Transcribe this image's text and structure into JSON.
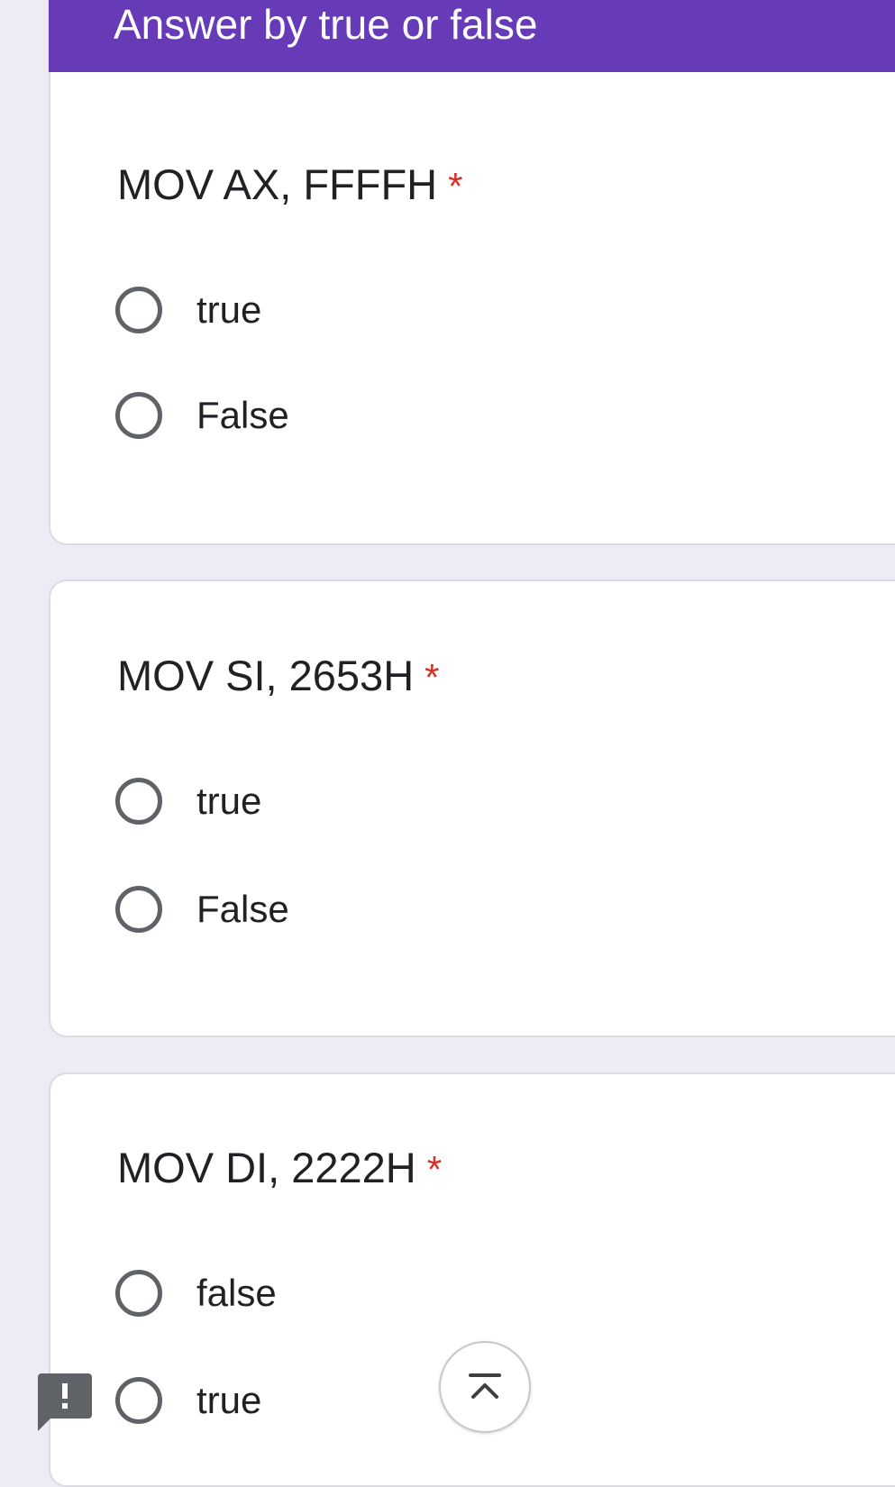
{
  "header": {
    "title": "Answer by true or false",
    "color": "#673ab7"
  },
  "questions": [
    {
      "title": "MOV AX, FFFFH",
      "required_mark": "*",
      "options": [
        {
          "label": "true",
          "selected": false
        },
        {
          "label": "False",
          "selected": false
        }
      ]
    },
    {
      "title": "MOV SI, 2653H",
      "required_mark": "*",
      "options": [
        {
          "label": "true",
          "selected": false
        },
        {
          "label": "False",
          "selected": false
        }
      ]
    },
    {
      "title": "MOV DI, 2222H",
      "required_mark": "*",
      "options": [
        {
          "label": "false",
          "selected": false
        },
        {
          "label": "true",
          "selected": false
        }
      ]
    }
  ],
  "controls": {
    "feedback_icon": "report-problem-icon",
    "scroll_top_icon": "vertical-align-top-icon"
  },
  "colors": {
    "background": "#eeebf7",
    "required": "#d93025",
    "radio_border": "#5f6368"
  }
}
